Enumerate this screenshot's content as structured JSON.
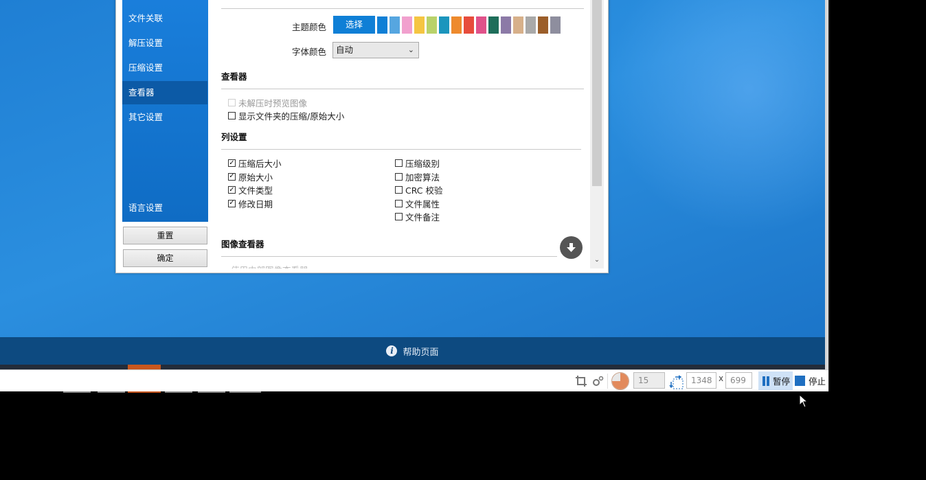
{
  "dialog": {
    "sidebar": {
      "items": [
        {
          "label": "文件关联"
        },
        {
          "label": "解压设置"
        },
        {
          "label": "压缩设置"
        },
        {
          "label": "查看器"
        },
        {
          "label": "其它设置"
        },
        {
          "label": "语言设置"
        }
      ],
      "active": "查看器",
      "reset_label": "重置",
      "ok_label": "确定"
    },
    "appearance": {
      "theme_color_label": "主题颜色",
      "choose_label": "选择",
      "swatch_colors": [
        "#0f7fd6",
        "#56a6e0",
        "#f1a0ce",
        "#f5c542",
        "#b9d26a",
        "#1b95bd",
        "#ee8a2d",
        "#e74c3c",
        "#e0528a",
        "#1e6e5a",
        "#8c7aa7",
        "#d7b08a",
        "#a9a9a9",
        "#9b5e2a",
        "#8e8e9e"
      ],
      "font_color_label": "字体颜色",
      "font_color_value": "自动"
    },
    "viewer": {
      "title": "查看器",
      "preview_unextracted_label": "未解压时预览图像",
      "show_folder_size_label": "显示文件夹的压缩/原始大小"
    },
    "columns": {
      "title": "列设置",
      "left": [
        {
          "label": "压缩后大小",
          "checked": true
        },
        {
          "label": "原始大小",
          "checked": true
        },
        {
          "label": "文件类型",
          "checked": true
        },
        {
          "label": "修改日期",
          "checked": true
        }
      ],
      "right": [
        {
          "label": "压缩级别",
          "checked": false
        },
        {
          "label": "加密算法",
          "checked": false
        },
        {
          "label": "CRC 校验",
          "checked": false
        },
        {
          "label": "文件属性",
          "checked": false
        },
        {
          "label": "文件备注",
          "checked": false
        }
      ]
    },
    "image_viewer": {
      "title": "图像查看器",
      "partial_option": "使用内部图像查看器"
    }
  },
  "background": {
    "help_label": "帮助页面"
  },
  "toolbar": {
    "fps": "15",
    "width": "1348",
    "height": "699",
    "times": "x",
    "pause_label": "暂停",
    "stop_label": "停止"
  }
}
